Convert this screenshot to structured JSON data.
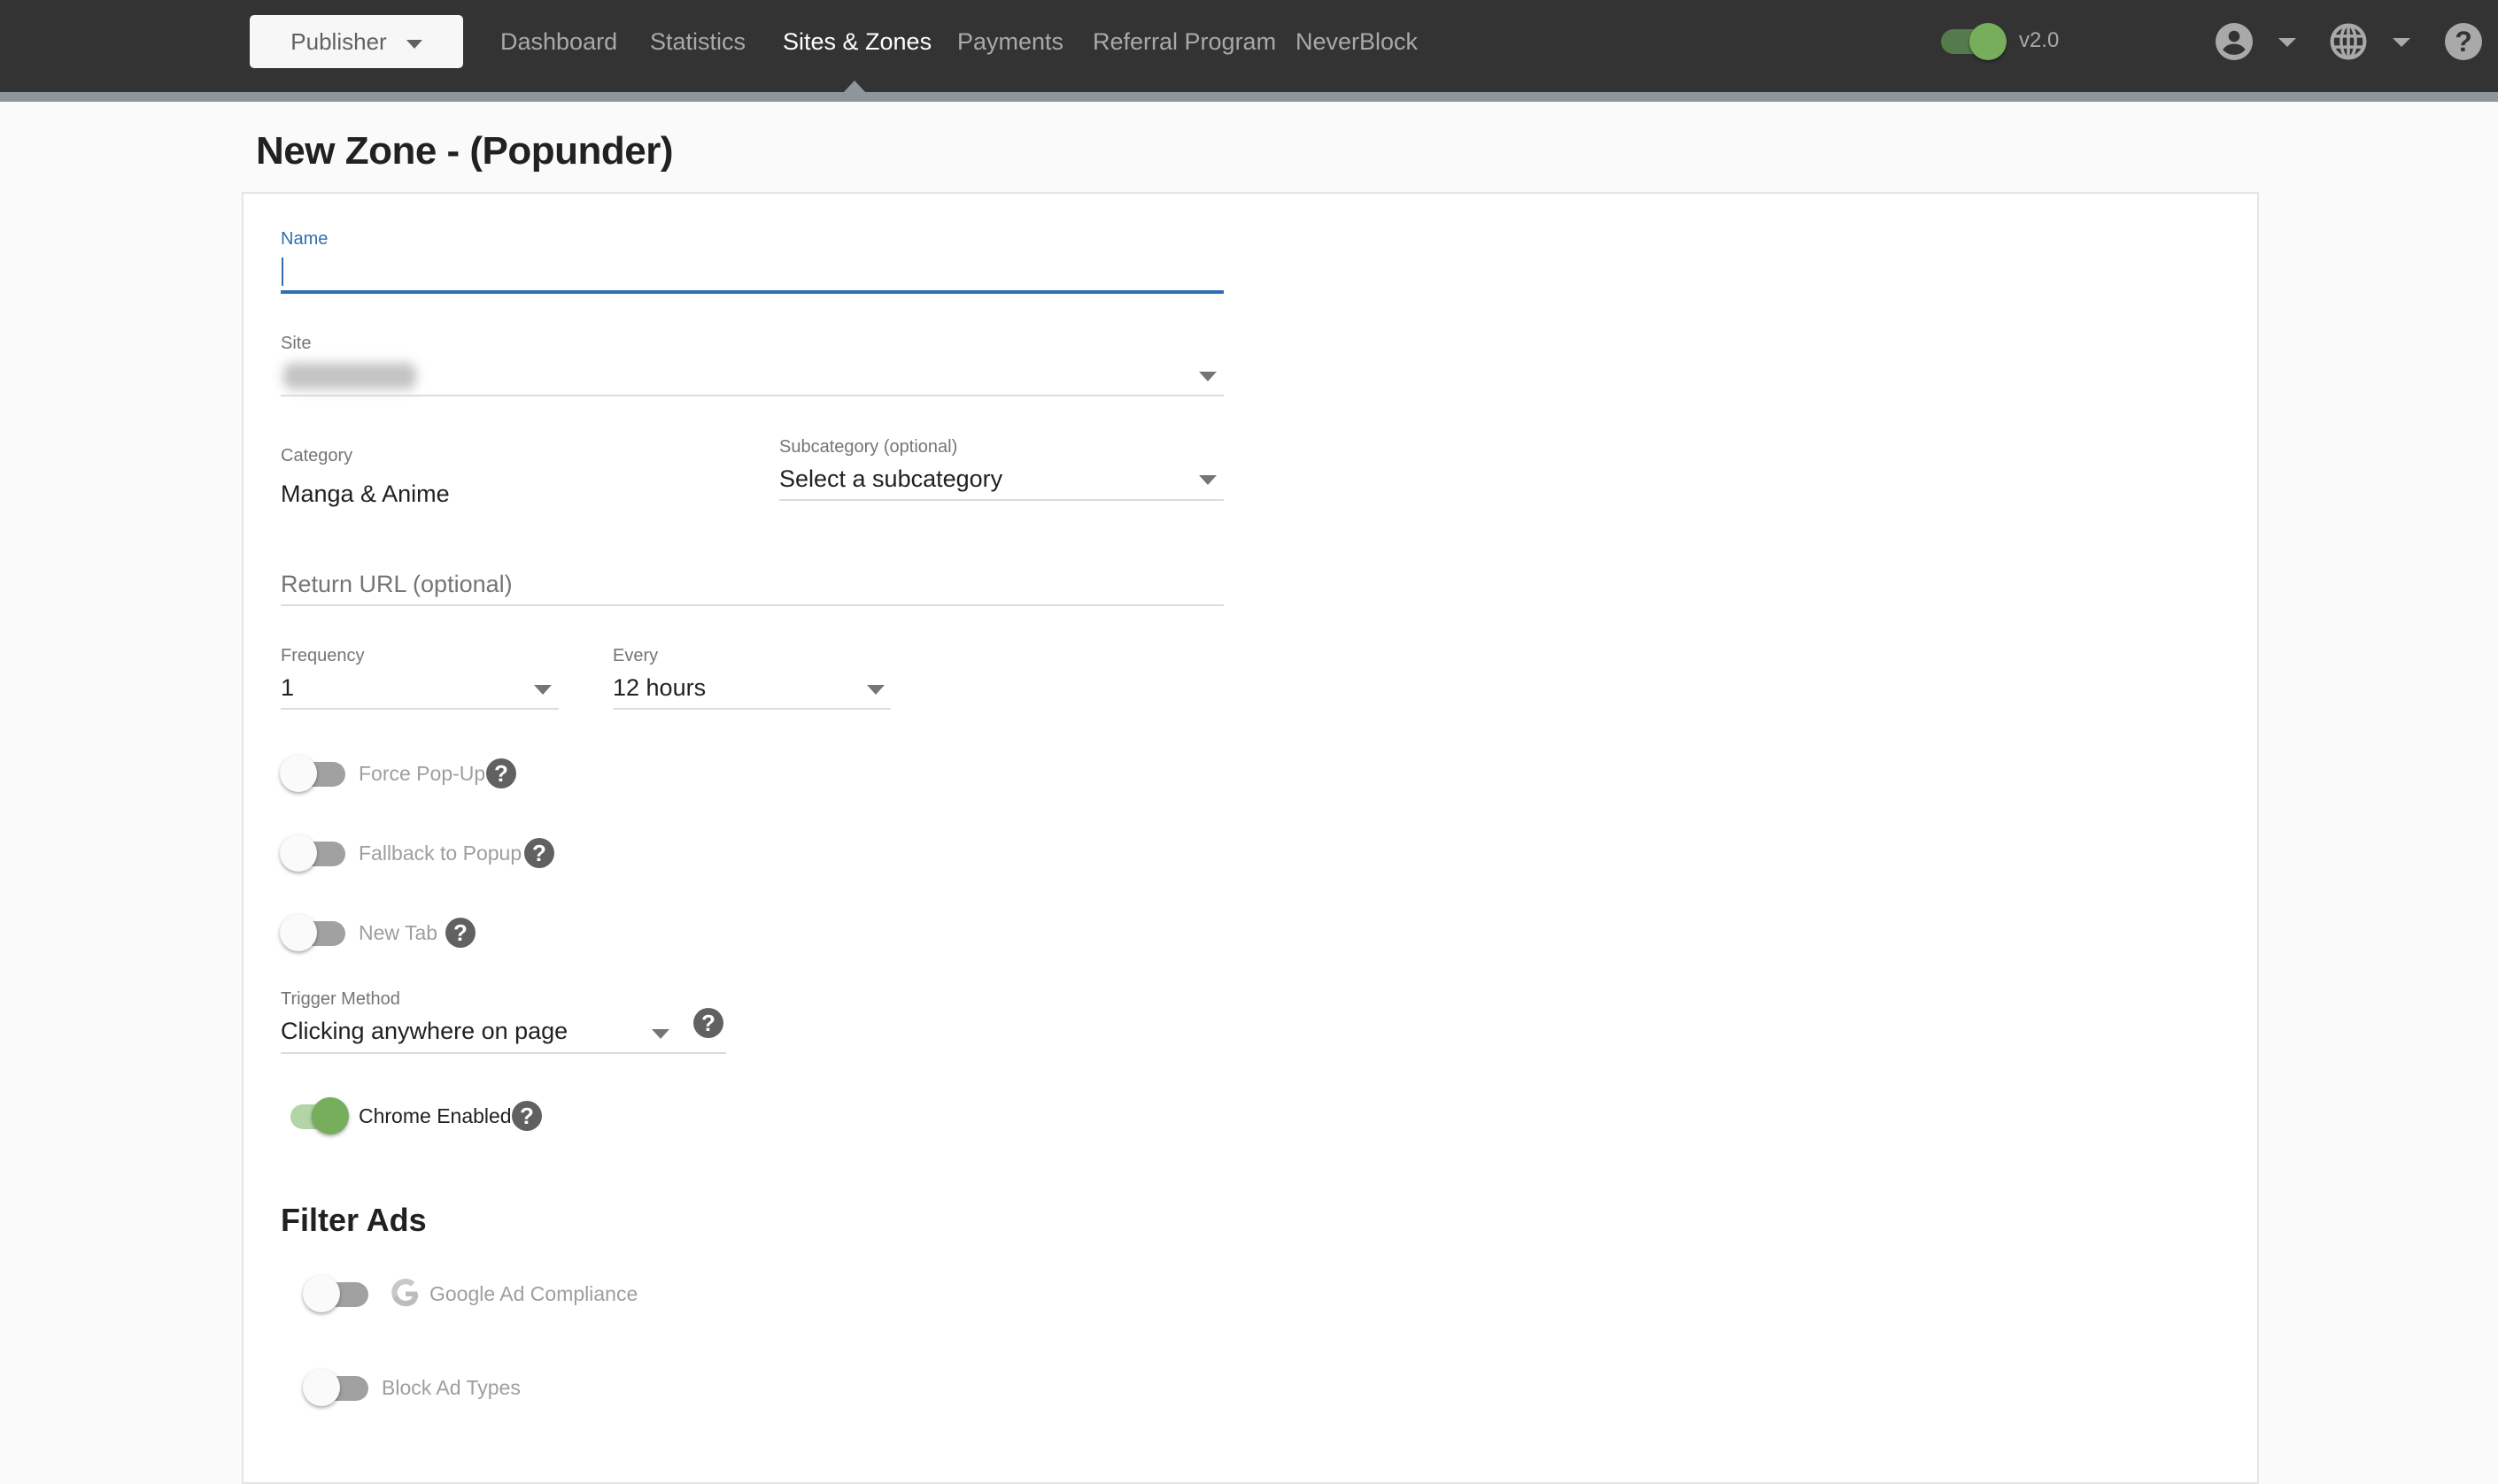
{
  "navbar": {
    "role_selector": "Publisher",
    "items": [
      {
        "label": "Dashboard",
        "active": false
      },
      {
        "label": "Statistics",
        "active": false
      },
      {
        "label": "Sites & Zones",
        "active": true
      },
      {
        "label": "Payments",
        "active": false
      },
      {
        "label": "Referral Program",
        "active": false
      },
      {
        "label": "NeverBlock",
        "active": false
      }
    ],
    "version_toggle": {
      "label": "v2.0",
      "on": true
    },
    "icons": [
      "user-icon",
      "globe-icon",
      "help-icon"
    ]
  },
  "page": {
    "title": "New Zone - (Popunder)"
  },
  "form": {
    "name": {
      "label": "Name",
      "value": "",
      "focused": true
    },
    "site": {
      "label": "Site",
      "value_redacted": true
    },
    "category": {
      "label": "Category",
      "value": "Manga & Anime"
    },
    "subcategory": {
      "label": "Subcategory (optional)",
      "value": "Select a subcategory"
    },
    "return_url": {
      "placeholder": "Return URL (optional)",
      "value": ""
    },
    "frequency": {
      "label": "Frequency",
      "value": "1"
    },
    "every": {
      "label": "Every",
      "value": "12 hours"
    },
    "force_popup": {
      "label": "Force Pop-Up",
      "on": false
    },
    "fallback_popup": {
      "label": "Fallback to Popup",
      "on": false
    },
    "new_tab": {
      "label": "New Tab",
      "on": false
    },
    "trigger_method": {
      "label": "Trigger Method",
      "value": "Clicking anywhere on page"
    },
    "chrome_enabled": {
      "label": "Chrome Enabled",
      "on": true
    },
    "help_glyph": "?"
  },
  "filter_ads": {
    "heading": "Filter Ads",
    "google_ad_compliance": {
      "label": "Google Ad Compliance",
      "on": false
    },
    "block_ad_types": {
      "label": "Block Ad Types",
      "on": false
    }
  },
  "colors": {
    "navbar_bg": "#333333",
    "accent_blue": "#2f6fb1",
    "toggle_green": "#76ae5b"
  }
}
